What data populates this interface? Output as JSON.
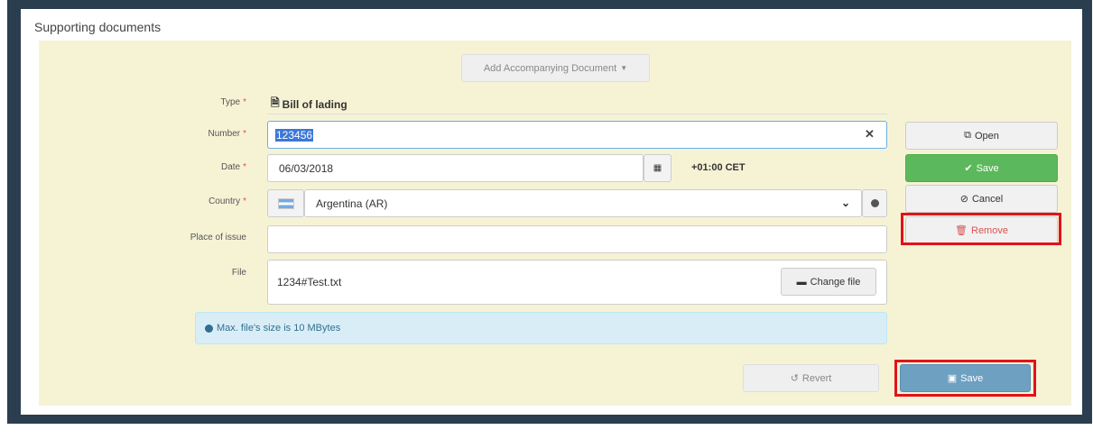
{
  "section": {
    "title": "Supporting documents"
  },
  "add_button": {
    "label": "Add Accompanying Document",
    "icon": "caret-down-icon"
  },
  "fields": {
    "type": {
      "label": "Type",
      "value": "Bill of lading",
      "icon": "document-icon"
    },
    "number": {
      "label": "Number",
      "value": "123456",
      "clear_icon": "✕"
    },
    "date": {
      "label": "Date",
      "value": "06/03/2018",
      "timezone": "+01:00 CET",
      "icon": "calendar-icon"
    },
    "country": {
      "label": "Country",
      "value": "Argentina (AR)",
      "icon": "globe-icon"
    },
    "place_of_issue": {
      "label": "Place of issue",
      "value": ""
    },
    "file": {
      "label": "File",
      "value": "1234#Test.txt",
      "change_label": "Change file"
    }
  },
  "required_marker": "*",
  "info": {
    "text": "Max. file's size is 10 MBytes"
  },
  "side_actions": {
    "open": "Open",
    "save": "Save",
    "cancel": "Cancel",
    "remove": "Remove"
  },
  "footer": {
    "revert": "Revert",
    "save": "Save"
  },
  "colors": {
    "frame": "#2b3e50",
    "panel_bg": "#f6f3d5",
    "green": "#5cb85c",
    "blue": "#6ea0c2",
    "danger": "#d9534f",
    "highlight": "#e2121a"
  }
}
